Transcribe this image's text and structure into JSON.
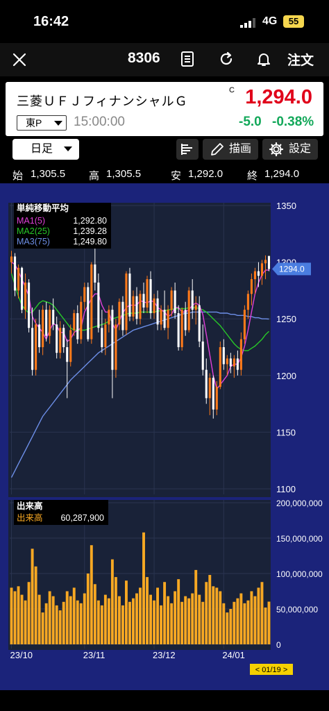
{
  "status": {
    "time": "16:42",
    "network": "4G",
    "battery": "55"
  },
  "nav": {
    "code": "8306",
    "order_label": "注文"
  },
  "quote": {
    "name": "三菱ＵＦＪフィナンシャルＧ",
    "flag": "C",
    "price": "1,294.0",
    "exchange": "東P",
    "time": "15:00:00",
    "change": "-5.0",
    "change_pct": "-0.38%"
  },
  "toolbar": {
    "period": "日足",
    "draw_label": "描画",
    "settings_label": "設定"
  },
  "ohlc": {
    "open_label": "始",
    "open": "1,305.5",
    "high_label": "高",
    "high": "1,305.5",
    "low_label": "安",
    "low": "1,292.0",
    "close_label": "終",
    "close": "1,294.0"
  },
  "colors": {
    "panel_bg": "#192238",
    "frame_bg": "#1b237a",
    "up_candle": "#ff7a1a",
    "down_candle": "#ffffff",
    "ma1": "#e040d8",
    "ma2": "#28c828",
    "ma3": "#6d8fe8",
    "volume": "#f7a823",
    "change_down": "#13a85a",
    "price": "#e0001a"
  },
  "chart_data": [
    {
      "type": "candlestick",
      "title": "単純移動平均",
      "ylim": [
        1100,
        1350
      ],
      "yticks": [
        "1350",
        "1300",
        "1250",
        "1200",
        "1150",
        "1100"
      ],
      "current_price_label": "1294.0",
      "current_price": 1294.0,
      "legend": [
        {
          "name": "MA1(5)",
          "value": "1,292.80"
        },
        {
          "name": "MA2(25)",
          "value": "1,239.28"
        },
        {
          "name": "MA3(75)",
          "value": "1,249.80"
        }
      ],
      "candles": [
        [
          1300,
          1310,
          1290,
          1305
        ],
        [
          1305,
          1308,
          1270,
          1275
        ],
        [
          1275,
          1298,
          1268,
          1295
        ],
        [
          1295,
          1296,
          1255,
          1258
        ],
        [
          1258,
          1290,
          1250,
          1282
        ],
        [
          1282,
          1285,
          1238,
          1242
        ],
        [
          1242,
          1260,
          1200,
          1205
        ],
        [
          1205,
          1250,
          1200,
          1245
        ],
        [
          1245,
          1258,
          1220,
          1225
        ],
        [
          1225,
          1262,
          1218,
          1258
        ],
        [
          1258,
          1265,
          1230,
          1235
        ],
        [
          1235,
          1262,
          1228,
          1258
        ],
        [
          1258,
          1268,
          1240,
          1245
        ],
        [
          1245,
          1252,
          1215,
          1220
        ],
        [
          1220,
          1248,
          1215,
          1242
        ],
        [
          1242,
          1245,
          1220,
          1225
        ],
        [
          1225,
          1232,
          1180,
          1212
        ],
        [
          1212,
          1245,
          1208,
          1240
        ],
        [
          1240,
          1258,
          1235,
          1255
        ],
        [
          1255,
          1262,
          1228,
          1232
        ],
        [
          1232,
          1270,
          1228,
          1265
        ],
        [
          1265,
          1282,
          1258,
          1278
        ],
        [
          1278,
          1282,
          1230,
          1232
        ],
        [
          1232,
          1300,
          1228,
          1298
        ],
        [
          1298,
          1312,
          1275,
          1282
        ],
        [
          1282,
          1290,
          1238,
          1242
        ],
        [
          1242,
          1258,
          1220,
          1225
        ],
        [
          1225,
          1250,
          1218,
          1245
        ],
        [
          1245,
          1262,
          1238,
          1258
        ],
        [
          1258,
          1262,
          1180,
          1205
        ],
        [
          1205,
          1250,
          1198,
          1245
        ],
        [
          1245,
          1268,
          1240,
          1265
        ],
        [
          1265,
          1270,
          1235,
          1240
        ],
        [
          1240,
          1292,
          1236,
          1290
        ],
        [
          1290,
          1295,
          1248,
          1252
        ],
        [
          1252,
          1275,
          1248,
          1270
        ],
        [
          1270,
          1278,
          1245,
          1250
        ],
        [
          1250,
          1275,
          1245,
          1272
        ],
        [
          1272,
          1282,
          1255,
          1260
        ],
        [
          1260,
          1288,
          1255,
          1285
        ],
        [
          1285,
          1292,
          1250,
          1255
        ],
        [
          1255,
          1272,
          1250,
          1268
        ],
        [
          1268,
          1275,
          1240,
          1245
        ],
        [
          1245,
          1262,
          1240,
          1258
        ],
        [
          1258,
          1275,
          1240,
          1242
        ],
        [
          1242,
          1262,
          1232,
          1258
        ],
        [
          1258,
          1278,
          1252,
          1275
        ],
        [
          1275,
          1282,
          1250,
          1255
        ],
        [
          1255,
          1262,
          1222,
          1225
        ],
        [
          1225,
          1260,
          1222,
          1258
        ],
        [
          1258,
          1265,
          1235,
          1240
        ],
        [
          1240,
          1278,
          1238,
          1275
        ],
        [
          1275,
          1285,
          1250,
          1258
        ],
        [
          1258,
          1270,
          1245,
          1262
        ],
        [
          1262,
          1270,
          1225,
          1230
        ],
        [
          1230,
          1245,
          1200,
          1205
        ],
        [
          1205,
          1215,
          1175,
          1180
        ],
        [
          1180,
          1202,
          1165,
          1198
        ],
        [
          1198,
          1200,
          1162,
          1170
        ],
        [
          1170,
          1195,
          1165,
          1190
        ],
        [
          1190,
          1230,
          1188,
          1225
        ],
        [
          1225,
          1232,
          1205,
          1210
        ],
        [
          1210,
          1218,
          1200,
          1215
        ],
        [
          1215,
          1220,
          1202,
          1208
        ],
        [
          1208,
          1218,
          1198,
          1215
        ],
        [
          1215,
          1222,
          1200,
          1205
        ],
        [
          1205,
          1238,
          1200,
          1232
        ],
        [
          1232,
          1262,
          1228,
          1258
        ],
        [
          1258,
          1275,
          1250,
          1272
        ],
        [
          1272,
          1290,
          1262,
          1285
        ],
        [
          1285,
          1295,
          1272,
          1292
        ],
        [
          1292,
          1300,
          1278,
          1288
        ],
        [
          1288,
          1302,
          1280,
          1299
        ],
        [
          1299,
          1306,
          1285,
          1302
        ],
        [
          1305.5,
          1305.5,
          1292,
          1294
        ]
      ],
      "ma1": [
        1300,
        1298,
        1292,
        1285,
        1278,
        1270,
        1252,
        1246,
        1242,
        1238,
        1232,
        1240,
        1246,
        1244,
        1238,
        1238,
        1230,
        1232,
        1238,
        1240,
        1242,
        1256,
        1262,
        1268,
        1272,
        1272,
        1262,
        1256,
        1256,
        1246,
        1240,
        1248,
        1255,
        1260,
        1262,
        1262,
        1262,
        1266,
        1265,
        1264,
        1266,
        1265,
        1260,
        1258,
        1256,
        1252,
        1254,
        1260,
        1260,
        1256,
        1256,
        1258,
        1262,
        1264,
        1262,
        1254,
        1236,
        1218,
        1200,
        1188,
        1192,
        1196,
        1200,
        1208,
        1210,
        1210,
        1216,
        1226,
        1240,
        1256,
        1272,
        1282,
        1289,
        1293,
        1293
      ],
      "ma2": [
        1290,
        1280,
        1270,
        1262,
        1258,
        1255,
        1256,
        1260,
        1264,
        1266,
        1265,
        1264,
        1262,
        1258,
        1254,
        1250,
        1246,
        1242,
        1240,
        1240,
        1240,
        1240,
        1241,
        1242,
        1243,
        1244,
        1245,
        1246,
        1248,
        1250,
        1251,
        1252,
        1253,
        1254,
        1255,
        1255,
        1255,
        1256,
        1256,
        1256,
        1256,
        1256,
        1257,
        1257,
        1257,
        1258,
        1258,
        1259,
        1259,
        1259,
        1259,
        1260,
        1260,
        1260,
        1259,
        1258,
        1256,
        1253,
        1250,
        1247,
        1244,
        1240,
        1236,
        1232,
        1228,
        1225,
        1223,
        1222,
        1222,
        1224,
        1226,
        1229,
        1232,
        1236,
        1239
      ],
      "ma3": [
        1110,
        1116,
        1122,
        1128,
        1134,
        1140,
        1146,
        1152,
        1158,
        1164,
        1168,
        1172,
        1176,
        1180,
        1184,
        1188,
        1192,
        1196,
        1199,
        1202,
        1205,
        1208,
        1211,
        1214,
        1217,
        1220,
        1222,
        1224,
        1226,
        1228,
        1230,
        1232,
        1234,
        1236,
        1238,
        1240,
        1241,
        1242,
        1243,
        1244,
        1245,
        1246,
        1247,
        1248,
        1249,
        1250,
        1251,
        1252,
        1253,
        1254,
        1255,
        1255,
        1256,
        1256,
        1256,
        1256,
        1256,
        1256,
        1256,
        1256,
        1255,
        1255,
        1255,
        1254,
        1254,
        1253,
        1253,
        1253,
        1252,
        1252,
        1251,
        1251,
        1250,
        1250,
        1249.8
      ]
    },
    {
      "type": "bar",
      "title": "出来高",
      "series_name": "出来高",
      "latest_value": "60,287,900",
      "ylim": [
        0,
        200000000
      ],
      "yticks": [
        "200,000,000",
        "150,000,000",
        "100,000,000",
        "50,000,000",
        "0"
      ],
      "x_labels": [
        "23/10",
        "23/11",
        "23/12",
        "24/01"
      ],
      "cursor_label": "< 01/19 >",
      "values": [
        80000000,
        75000000,
        82000000,
        70000000,
        62000000,
        88000000,
        135000000,
        110000000,
        70000000,
        45000000,
        58000000,
        75000000,
        68000000,
        55000000,
        48000000,
        60000000,
        75000000,
        68000000,
        80000000,
        62000000,
        58000000,
        72000000,
        100000000,
        140000000,
        85000000,
        62000000,
        55000000,
        70000000,
        65000000,
        120000000,
        95000000,
        68000000,
        55000000,
        90000000,
        60000000,
        65000000,
        72000000,
        80000000,
        158000000,
        95000000,
        70000000,
        62000000,
        80000000,
        55000000,
        88000000,
        68000000,
        58000000,
        75000000,
        92000000,
        60000000,
        68000000,
        65000000,
        72000000,
        105000000,
        70000000,
        60000000,
        88000000,
        98000000,
        82000000,
        80000000,
        75000000,
        58000000,
        45000000,
        50000000,
        60000000,
        65000000,
        72000000,
        58000000,
        62000000,
        75000000,
        68000000,
        80000000,
        88000000,
        52000000,
        60287900
      ]
    }
  ]
}
